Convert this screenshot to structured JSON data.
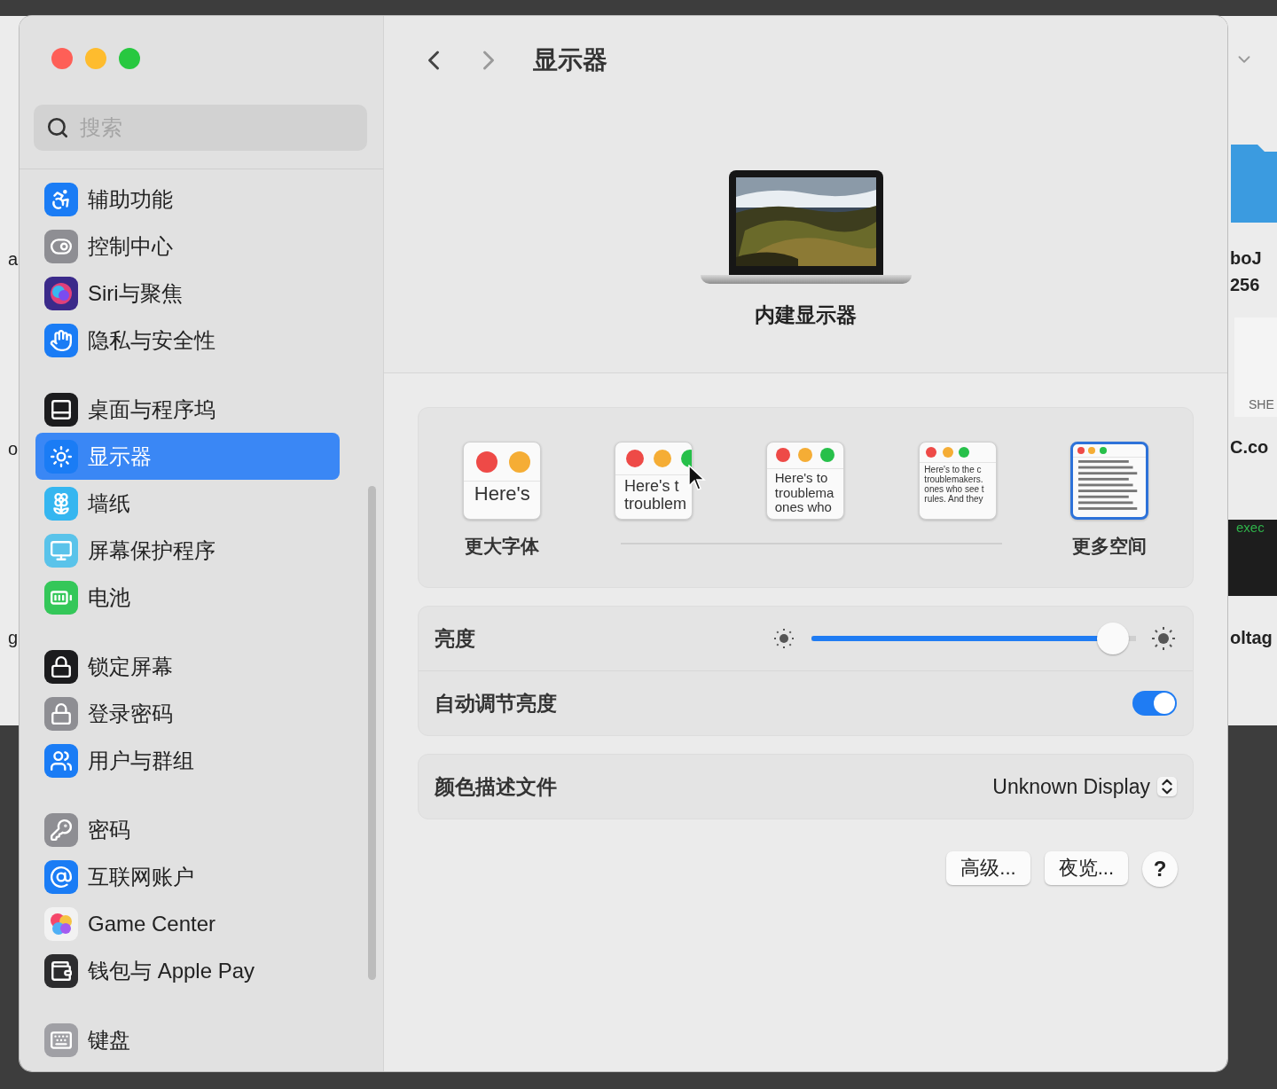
{
  "background_window": {
    "left_fragments": [
      "a",
      "o",
      "g"
    ],
    "right_fragments": [
      {
        "kind": "text",
        "text": "boJ"
      },
      {
        "kind": "text",
        "text": "256"
      },
      {
        "kind": "doc",
        "text": "SHE"
      },
      {
        "kind": "text",
        "text": "C.co"
      },
      {
        "kind": "terminal",
        "text": "exec"
      },
      {
        "kind": "text",
        "text": "oltag"
      }
    ]
  },
  "sidebar": {
    "search": {
      "placeholder": "搜索"
    },
    "groups": [
      {
        "items": [
          {
            "label": "辅助功能",
            "color": "#1a7cf5",
            "selected": false
          },
          {
            "label": "控制中心",
            "color": "#8e8e93",
            "selected": false
          },
          {
            "label": "Siri与聚焦",
            "color": "#3b2a8a",
            "selected": false
          },
          {
            "label": "隐私与安全性",
            "color": "#1a7cf5",
            "selected": false
          }
        ]
      },
      {
        "items": [
          {
            "label": "桌面与程序坞",
            "color": "#1c1c1e",
            "selected": false
          },
          {
            "label": "显示器",
            "color": "#1a7cf5",
            "selected": true
          },
          {
            "label": "墙纸",
            "color": "#35b6f0",
            "selected": false
          },
          {
            "label": "屏幕保护程序",
            "color": "#5ac3ea",
            "selected": false
          },
          {
            "label": "电池",
            "color": "#34c759",
            "selected": false
          }
        ]
      },
      {
        "items": [
          {
            "label": "锁定屏幕",
            "color": "#1c1c1e",
            "selected": false
          },
          {
            "label": "登录密码",
            "color": "#8e8e93",
            "selected": false
          },
          {
            "label": "用户与群组",
            "color": "#1a7cf5",
            "selected": false
          }
        ]
      },
      {
        "items": [
          {
            "label": "密码",
            "color": "#8e8e93",
            "selected": false
          },
          {
            "label": "互联网账户",
            "color": "#1a7cf5",
            "selected": false
          },
          {
            "label": "Game Center",
            "color": "#f2f2f2",
            "selected": false
          },
          {
            "label": "钱包与 Apple Pay",
            "color": "#2c2c2e",
            "selected": false
          }
        ]
      },
      {
        "items": [
          {
            "label": "键盘",
            "color": "#a0a0a5",
            "selected": false
          }
        ]
      }
    ]
  },
  "content": {
    "title": "显示器",
    "display": {
      "name": "内建显示器"
    },
    "resolution_options": [
      {
        "kind": "text",
        "preview_lines": [
          "Here's"
        ],
        "label": "更大字体",
        "selected": false
      },
      {
        "kind": "text",
        "preview_lines": [
          "Here's t",
          "troublem"
        ],
        "selected": false
      },
      {
        "kind": "text",
        "preview_lines": [
          "Here's to",
          "troublema",
          "ones who"
        ],
        "selected": false
      },
      {
        "kind": "text",
        "preview_lines": [
          "Here's to the c",
          "troublemakers.",
          "ones who see t",
          "rules. And they"
        ],
        "selected": false
      },
      {
        "kind": "lines",
        "label": "更多空间",
        "selected": true
      }
    ],
    "brightness": {
      "label": "亮度",
      "level": 0.93
    },
    "auto_brightness": {
      "label": "自动调节亮度",
      "on": true
    },
    "color_profile": {
      "label": "颜色描述文件",
      "value": "Unknown Display"
    },
    "buttons": [
      "高级...",
      "夜览...",
      "?"
    ]
  }
}
